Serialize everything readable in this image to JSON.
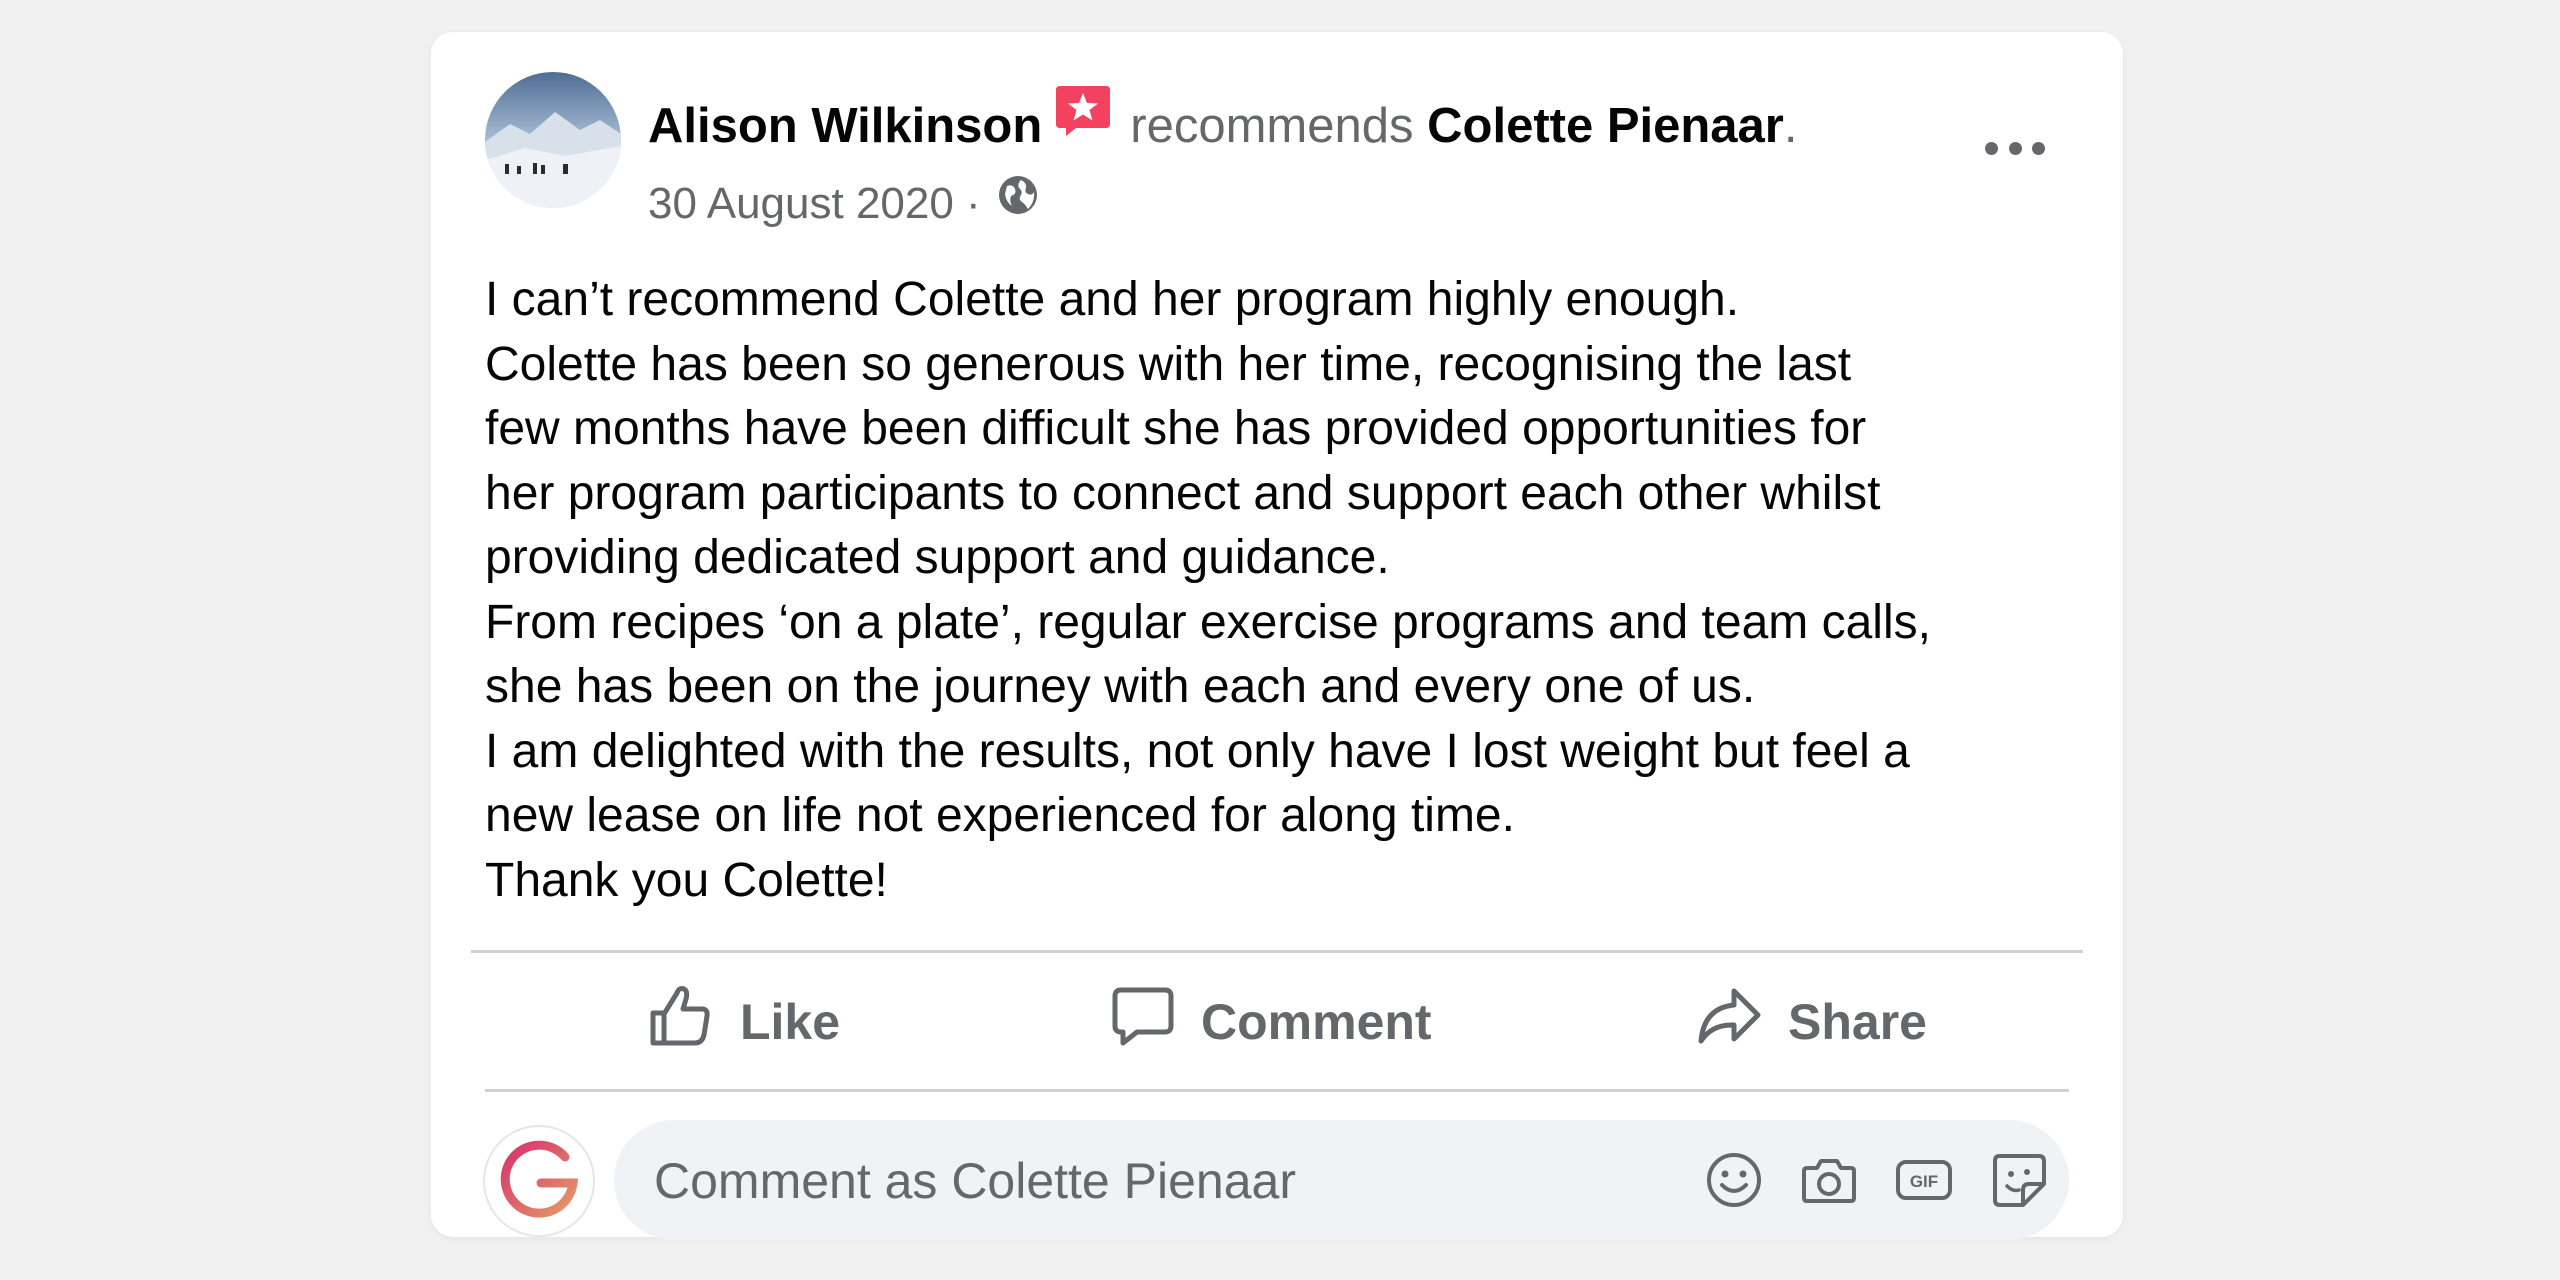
{
  "post": {
    "author": "Alison Wilkinson",
    "action": "recommends",
    "target": "Colette Pienaar",
    "target_suffix": ".",
    "date": "30 August 2020 ·",
    "body_lines": [
      "I can’t recommend Colette and her program highly enough.",
      "Colette has been so generous with her time, recognising the last",
      "few months have been difficult she has provided opportunities for",
      "her program participants to connect and support each other whilst",
      "providing dedicated support and guidance.",
      "From recipes ‘on a plate’, regular exercise programs and team calls,",
      "she has been on the journey with each and every one of us.",
      "I am delighted with the results, not only have I lost weight but feel a",
      "new lease on life not experienced for along time.",
      "Thank you Colette!"
    ]
  },
  "actions": {
    "like": "Like",
    "comment": "Comment",
    "share": "Share"
  },
  "comment_box": {
    "placeholder": "Comment as Colette Pienaar"
  },
  "icons": {
    "recommend": "recommend-star-icon",
    "privacy": "globe-icon",
    "more": "more-options-icon",
    "like": "thumbs-up-icon",
    "comment": "speech-bubble-icon",
    "share": "share-arrow-icon",
    "emoji": "smiley-icon",
    "camera": "camera-icon",
    "gif": "gif-icon",
    "sticker": "sticker-icon"
  },
  "colors": {
    "recommend_badge": "#f3425f",
    "secondary_text": "#65676b",
    "background": "#f0f0f1"
  }
}
